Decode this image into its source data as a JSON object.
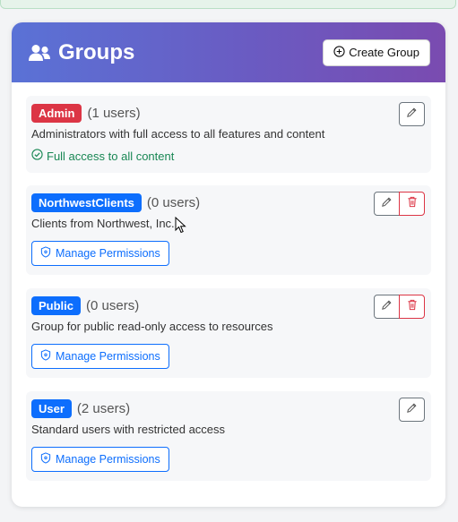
{
  "header": {
    "title": "Groups",
    "create_label": "Create Group"
  },
  "groups": [
    {
      "name": "Admin",
      "count": "(1 users)",
      "description": "Administrators with full access to all features and content",
      "note": "Full access to all content"
    },
    {
      "name": "NorthwestClients",
      "count": "(0 users)",
      "description": "Clients from Northwest, Inc.",
      "permissions_label": "Manage Permissions"
    },
    {
      "name": "Public",
      "count": "(0 users)",
      "description": "Group for public read-only access to resources",
      "permissions_label": "Manage Permissions"
    },
    {
      "name": "User",
      "count": "(2 users)",
      "description": "Standard users with restricted access",
      "permissions_label": "Manage Permissions"
    }
  ],
  "colors": {
    "header_gradient_start": "#5a72d6",
    "header_gradient_end": "#7a4bb0",
    "admin_badge": "#dc3545",
    "group_badge": "#0d6efd",
    "success_text": "#198754",
    "danger": "#dc3545"
  },
  "icons": {
    "title": "users-icon",
    "create": "plus-circle-icon",
    "note": "check-circle-icon",
    "permissions": "shield-icon",
    "edit": "pencil-icon",
    "delete": "trash-icon"
  }
}
